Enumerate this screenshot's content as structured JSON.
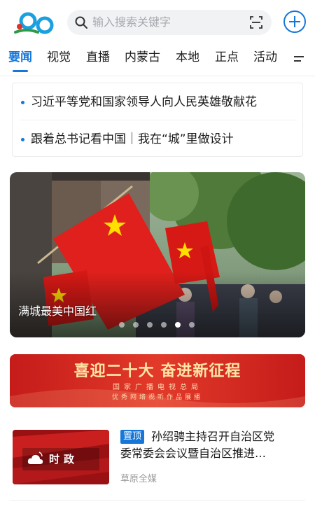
{
  "header": {
    "logo_icon": "app-logo-icon",
    "search_placeholder": "输入搜索关键字",
    "search_icon": "search-icon",
    "scan_icon": "scan-icon",
    "add_icon": "plus-circle-icon",
    "accent": "#1677d9"
  },
  "tabs": {
    "items": [
      {
        "label": "要闻",
        "active": true
      },
      {
        "label": "视觉",
        "active": false
      },
      {
        "label": "直播",
        "active": false
      },
      {
        "label": "内蒙古",
        "active": false
      },
      {
        "label": "本地",
        "active": false
      },
      {
        "label": "正点",
        "active": false
      },
      {
        "label": "活动",
        "active": false
      }
    ],
    "menu_icon": "menu-icon"
  },
  "headlines": [
    {
      "text": "习近平等党和国家领导人向人民英雄敬献花"
    },
    {
      "text": "跟着总书记看中国｜我在“城”里做设计"
    }
  ],
  "banner": {
    "caption": "满城最美中国红",
    "page_count": 6,
    "active_index": 4
  },
  "promo": {
    "title": "喜迎二十大 奋进新征程",
    "subtitle": "国家广播电视总局",
    "subtitle2": "优秀网络视听作品展播"
  },
  "news": {
    "thumb_label": "时政",
    "thumb_icon": "cloud-broadcast-icon",
    "pin_label": "置顶",
    "title_line1": "孙绍骋主持召开自治区党",
    "title_line2": "委常委会会议暨自治区推进…",
    "source": "草原全媒"
  }
}
